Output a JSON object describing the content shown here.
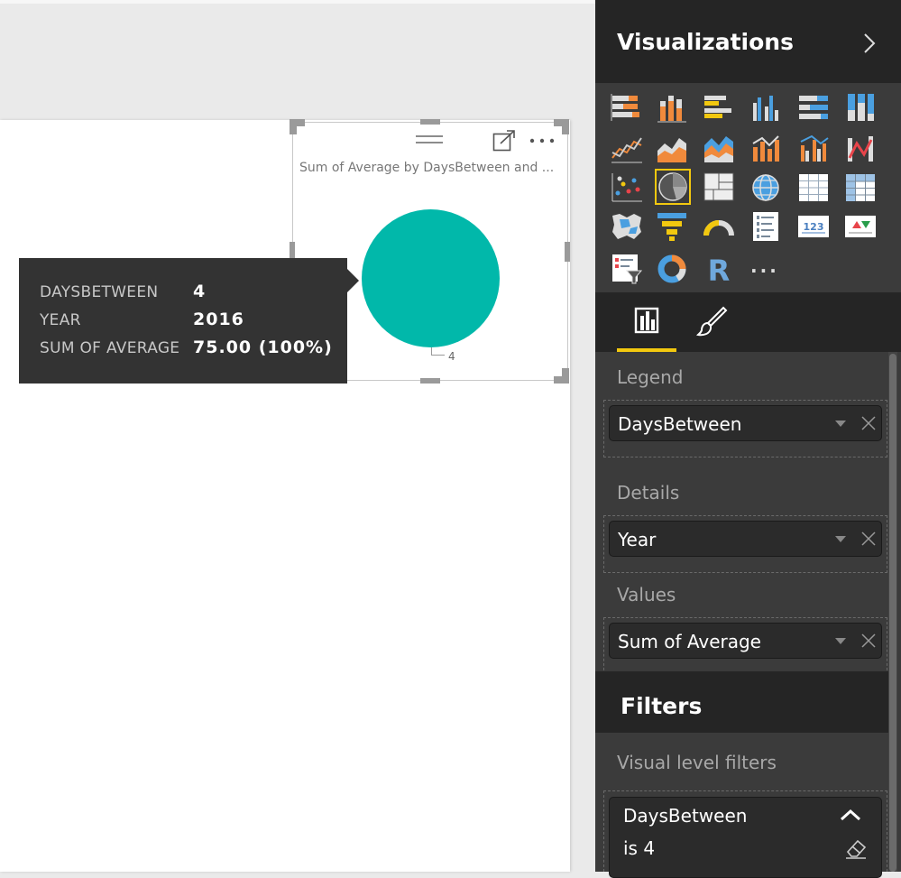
{
  "visual": {
    "title": "Sum of Average by DaysBetween and ...",
    "pie_label": "4",
    "colors": {
      "slice": "#01b8aa"
    }
  },
  "chart_data": {
    "type": "pie",
    "title": "Sum of Average by DaysBetween and ...",
    "categories": [
      "4"
    ],
    "values": [
      75.0
    ]
  },
  "tooltip": {
    "rows": [
      {
        "key": "DAYSBETWEEN",
        "value": "4"
      },
      {
        "key": "YEAR",
        "value": "2016"
      },
      {
        "key": "SUM OF AVERAGE",
        "value": "75.00 (100%)"
      }
    ]
  },
  "pane": {
    "title": "Visualizations",
    "more_label": "...",
    "tabs": [
      "fields-tab",
      "format-tab"
    ],
    "accent_color": "#f2c80f"
  },
  "wells": {
    "legend": {
      "label": "Legend",
      "field": "DaysBetween"
    },
    "details": {
      "label": "Details",
      "field": "Year"
    },
    "values": {
      "label": "Values",
      "field": "Sum of Average"
    }
  },
  "filters": {
    "title": "Filters",
    "section_label": "Visual level filters",
    "card": {
      "field": "DaysBetween",
      "condition": "is 4"
    }
  }
}
